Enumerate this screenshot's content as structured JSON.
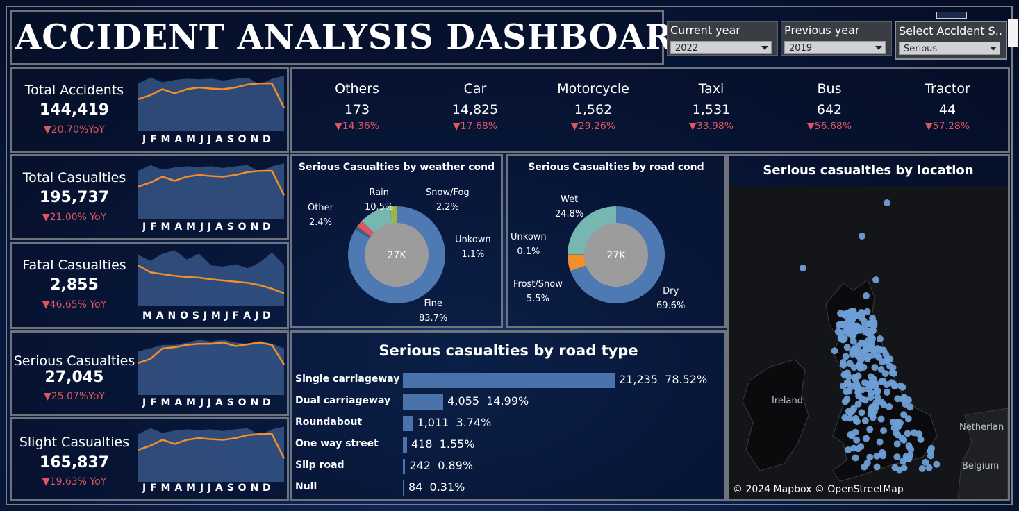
{
  "title": "ACCIDENT ANALYSIS DASHBOARD",
  "filters": [
    {
      "label": "Current year",
      "value": "2022"
    },
    {
      "label": "Previous year",
      "value": "2019"
    },
    {
      "label": "Select Accident S...",
      "value": "Serious"
    }
  ],
  "kpis": [
    {
      "name": "Total Accidents",
      "value": "144,419",
      "yoy": "▼20.70%YoY",
      "months": "J F M A M J J A S O N D",
      "area": [
        0.82,
        0.92,
        0.84,
        0.88,
        0.9,
        0.89,
        0.9,
        0.87,
        0.9,
        0.92,
        0.8,
        0.9,
        0.95
      ],
      "line": [
        0.55,
        0.62,
        0.72,
        0.65,
        0.72,
        0.75,
        0.73,
        0.72,
        0.75,
        0.8,
        0.82,
        0.82,
        0.4
      ]
    },
    {
      "name": "Total Casualties",
      "value": "195,737",
      "yoy": "▼21.00% YoY",
      "months": "J F M A M J J A S O N D",
      "area": [
        0.82,
        0.92,
        0.84,
        0.88,
        0.9,
        0.89,
        0.9,
        0.87,
        0.9,
        0.92,
        0.8,
        0.9,
        0.95
      ],
      "line": [
        0.55,
        0.62,
        0.72,
        0.65,
        0.72,
        0.75,
        0.73,
        0.72,
        0.75,
        0.8,
        0.82,
        0.82,
        0.4
      ]
    },
    {
      "name": "Fatal Casualties",
      "value": "2,855",
      "yoy": "▼46.65% YoY",
      "months": "M A N O S J M J F A J D",
      "area": [
        0.88,
        0.78,
        0.9,
        0.96,
        0.8,
        0.9,
        0.7,
        0.68,
        0.72,
        0.65,
        0.75,
        0.92,
        0.7
      ],
      "line": [
        0.7,
        0.58,
        0.55,
        0.52,
        0.5,
        0.49,
        0.46,
        0.44,
        0.42,
        0.4,
        0.36,
        0.3,
        0.22
      ]
    },
    {
      "name": "Serious Casualties",
      "value": "27,045",
      "yoy": "▼25.07%YoY",
      "months": "J F M A M J J A S O N D",
      "area": [
        0.75,
        0.8,
        0.86,
        0.86,
        0.9,
        0.95,
        0.92,
        0.95,
        0.9,
        0.88,
        0.93,
        0.88,
        0.8
      ],
      "line": [
        0.55,
        0.62,
        0.8,
        0.82,
        0.86,
        0.88,
        0.88,
        0.9,
        0.84,
        0.87,
        0.9,
        0.86,
        0.52
      ]
    },
    {
      "name": "Slight Casualties",
      "value": "165,837",
      "yoy": "▼19.63% YoY",
      "months": "J F M A M J J A S O N D",
      "area": [
        0.82,
        0.92,
        0.84,
        0.88,
        0.9,
        0.89,
        0.9,
        0.87,
        0.9,
        0.92,
        0.8,
        0.9,
        0.95
      ],
      "line": [
        0.55,
        0.62,
        0.72,
        0.65,
        0.72,
        0.75,
        0.73,
        0.72,
        0.75,
        0.8,
        0.82,
        0.82,
        0.4
      ]
    }
  ],
  "vehicles": [
    {
      "name": "Others",
      "value": "173",
      "yoy": "▼14.36%"
    },
    {
      "name": "Car",
      "value": "14,825",
      "yoy": "▼17.68%"
    },
    {
      "name": "Motorcycle",
      "value": "1,562",
      "yoy": "▼29.26%"
    },
    {
      "name": "Taxi",
      "value": "1,531",
      "yoy": "▼33.98%"
    },
    {
      "name": "Bus",
      "value": "642",
      "yoy": "▼56.68%"
    },
    {
      "name": "Tractor",
      "value": "44",
      "yoy": "▼57.28%"
    }
  ],
  "weather": {
    "title": "Serious Casualties by weather cond",
    "center": "27K",
    "slices": [
      {
        "name": "Fine",
        "pct": "83.7%",
        "value": 83.7,
        "color": "#4e79b3"
      },
      {
        "name": "Unkown",
        "pct": "1.1%",
        "value": 1.1,
        "color": "#3e5f8d"
      },
      {
        "name": "Other",
        "pct": "2.4%",
        "value": 2.4,
        "color": "#e15759"
      },
      {
        "name": "Rain",
        "pct": "10.5%",
        "value": 10.5,
        "color": "#76b7b2"
      },
      {
        "name": "Snow/Fog",
        "pct": "2.2%",
        "value": 2.2,
        "color": "#9bb83c"
      }
    ]
  },
  "road_cond": {
    "title": "Serious Casualties by road cond",
    "center": "27K",
    "slices": [
      {
        "name": "Dry",
        "pct": "69.6%",
        "value": 69.6,
        "color": "#4e79b3"
      },
      {
        "name": "Frost/Snow",
        "pct": "5.5%",
        "value": 5.5,
        "color": "#f28e2b"
      },
      {
        "name": "Unkown",
        "pct": "0.1%",
        "value": 0.1,
        "color": "#3e5f8d"
      },
      {
        "name": "Wet",
        "pct": "24.8%",
        "value": 24.8,
        "color": "#76b7b2"
      }
    ]
  },
  "road_type": {
    "title": "Serious  casualties by road type",
    "rows": [
      {
        "name": "Single carriageway",
        "count": "21,235",
        "pct": "78.52%",
        "value": 21235
      },
      {
        "name": "Dual carriageway",
        "count": "4,055",
        "pct": "14.99%",
        "value": 4055
      },
      {
        "name": "Roundabout",
        "count": "1,011",
        "pct": "3.74%",
        "value": 1011
      },
      {
        "name": "One way street",
        "count": "418",
        "pct": "1.55%",
        "value": 418
      },
      {
        "name": "Slip road",
        "count": "242",
        "pct": "0.89%",
        "value": 242
      },
      {
        "name": "Null",
        "count": "84",
        "pct": "0.31%",
        "value": 84
      }
    ]
  },
  "map": {
    "title": "Serious  casualties by location",
    "attribution": "© 2024 Mapbox © OpenStreetMap",
    "labels": {
      "ireland": "Ireland",
      "netherlands": "Netherlan",
      "belgium": "Belgium"
    }
  },
  "colors": {
    "accent_line": "#f28e2b",
    "area": "#4e79b3",
    "negative": "#e05560"
  }
}
